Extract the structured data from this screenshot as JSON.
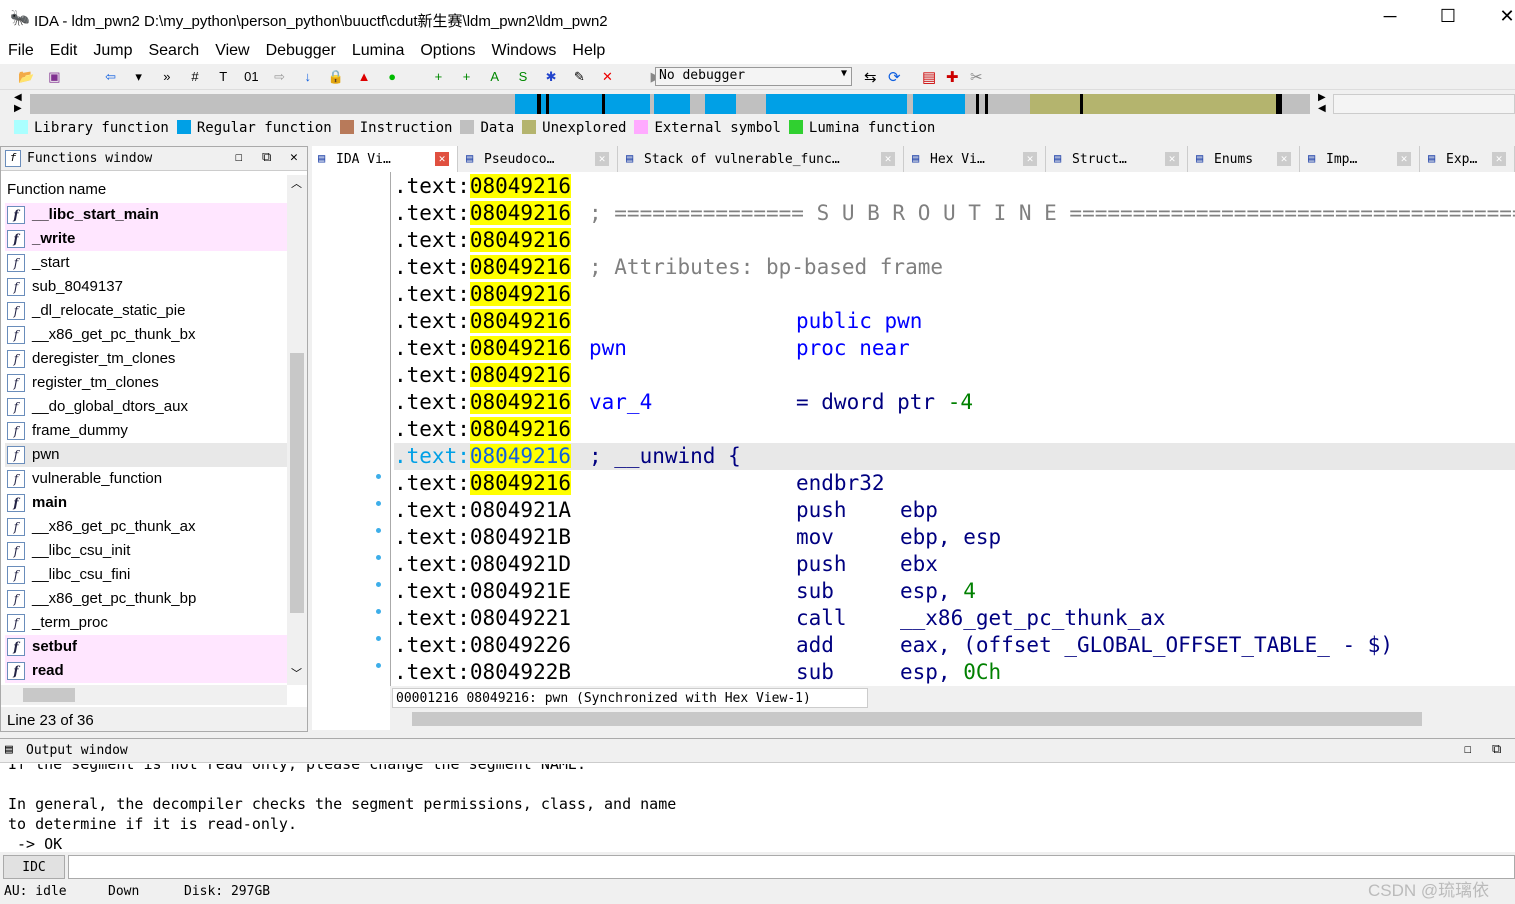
{
  "window": {
    "title": "IDA - ldm_pwn2 D:\\my_python\\person_python\\buuctf\\cdut新生赛\\ldm_pwn2\\ldm_pwn2",
    "minimize": "─",
    "maximize": "☐",
    "close": "✕"
  },
  "menu": [
    "File",
    "Edit",
    "Jump",
    "Search",
    "View",
    "Debugger",
    "Lumina",
    "Options",
    "Windows",
    "Help"
  ],
  "toolbar": {
    "debugger_select": "No debugger"
  },
  "legend": [
    {
      "label": "Library function",
      "color": "#aaffff"
    },
    {
      "label": "Regular function",
      "color": "#00a0e6"
    },
    {
      "label": "Instruction",
      "color": "#b87a5a"
    },
    {
      "label": "Data",
      "color": "#c0c0c0"
    },
    {
      "label": "Unexplored",
      "color": "#b4b46e"
    },
    {
      "label": "External symbol",
      "color": "#ffaaff"
    },
    {
      "label": "Lumina function",
      "color": "#30d030"
    }
  ],
  "functions_window": {
    "title": "Functions window",
    "column": "Function name",
    "status": "Line 23 of 36",
    "items": [
      {
        "name": "__libc_start_main",
        "bold": true,
        "pink": true
      },
      {
        "name": "_write",
        "bold": true,
        "pink": true
      },
      {
        "name": "_start"
      },
      {
        "name": "sub_8049137"
      },
      {
        "name": "_dl_relocate_static_pie"
      },
      {
        "name": "__x86_get_pc_thunk_bx"
      },
      {
        "name": "deregister_tm_clones"
      },
      {
        "name": "register_tm_clones"
      },
      {
        "name": "__do_global_dtors_aux"
      },
      {
        "name": "frame_dummy"
      },
      {
        "name": "pwn",
        "selected": true
      },
      {
        "name": "vulnerable_function"
      },
      {
        "name": "main",
        "bold": true
      },
      {
        "name": "__x86_get_pc_thunk_ax"
      },
      {
        "name": "__libc_csu_init"
      },
      {
        "name": "__libc_csu_fini"
      },
      {
        "name": "__x86_get_pc_thunk_bp"
      },
      {
        "name": "_term_proc"
      },
      {
        "name": "setbuf",
        "bold": true,
        "pink": true
      },
      {
        "name": "read",
        "bold": true,
        "pink": true
      }
    ]
  },
  "tabs": [
    {
      "label": "IDA Vi…",
      "active": true
    },
    {
      "label": "Pseudoco…"
    },
    {
      "label": "Stack of vulnerable_func…"
    },
    {
      "label": "Hex Vi…"
    },
    {
      "label": "Struct…"
    },
    {
      "label": "Enums"
    },
    {
      "label": "Imp…"
    },
    {
      "label": "Exp…"
    }
  ],
  "disasm": {
    "lines": [
      {
        "seg": ".text:",
        "addr": "08049216",
        "hl": true
      },
      {
        "seg": ".text:",
        "addr": "08049216",
        "hl": true,
        "comment": "; =============== S U B R O U T I N E ======================================="
      },
      {
        "seg": ".text:",
        "addr": "08049216",
        "hl": true
      },
      {
        "seg": ".text:",
        "addr": "08049216",
        "hl": true,
        "comment": "; Attributes: bp-based frame"
      },
      {
        "seg": ".text:",
        "addr": "08049216",
        "hl": true
      },
      {
        "seg": ".text:",
        "addr": "08049216",
        "hl": true,
        "mnem": "public pwn"
      },
      {
        "seg": ".text:",
        "addr": "08049216",
        "hl": true,
        "label": "pwn",
        "mnem": "proc near"
      },
      {
        "seg": ".text:",
        "addr": "08049216",
        "hl": true
      },
      {
        "seg": ".text:",
        "addr": "08049216",
        "hl": true,
        "label": "var_4",
        "mnem": "= dword ptr ",
        "num": "-4"
      },
      {
        "seg": ".text:",
        "addr": "08049216",
        "hl": true
      },
      {
        "seg": ".text:",
        "addr": "08049216",
        "hl": true,
        "cur": true,
        "unwind": "; __unwind {"
      },
      {
        "seg": ".text:",
        "addr": "08049216",
        "hl": true,
        "mnem": "endbr32"
      },
      {
        "seg": ".text:",
        "addr": "0804921A",
        "mnem": "push",
        "ops": "ebp"
      },
      {
        "seg": ".text:",
        "addr": "0804921B",
        "mnem": "mov",
        "ops": "ebp, esp"
      },
      {
        "seg": ".text:",
        "addr": "0804921D",
        "mnem": "push",
        "ops": "ebx"
      },
      {
        "seg": ".text:",
        "addr": "0804921E",
        "mnem": "sub",
        "ops": "esp, ",
        "num": "4"
      },
      {
        "seg": ".text:",
        "addr": "08049221",
        "mnem": "call",
        "ops": "__x86_get_pc_thunk_ax"
      },
      {
        "seg": ".text:",
        "addr": "08049226",
        "mnem": "add",
        "ops": "eax, (offset _GLOBAL_OFFSET_TABLE_ - $)"
      },
      {
        "seg": ".text:",
        "addr": "0804922B",
        "mnem": "sub",
        "ops": "esp, ",
        "num": "0Ch"
      }
    ],
    "status": "00001216 08049216: pwn (Synchronized with Hex View-1)"
  },
  "output": {
    "title": "Output window",
    "lines": [
      "If the segment is not read only, please change the segment NAME.",
      "",
      "In general, the decompiler checks the segment permissions, class, and name",
      "to determine if it is read-only.",
      " -> OK"
    ],
    "idc_button": "IDC"
  },
  "statusbar": {
    "au": "AU:  idle",
    "dir": "Down",
    "disk": "Disk: 297GB"
  },
  "watermark": "CSDN @琉璃依"
}
